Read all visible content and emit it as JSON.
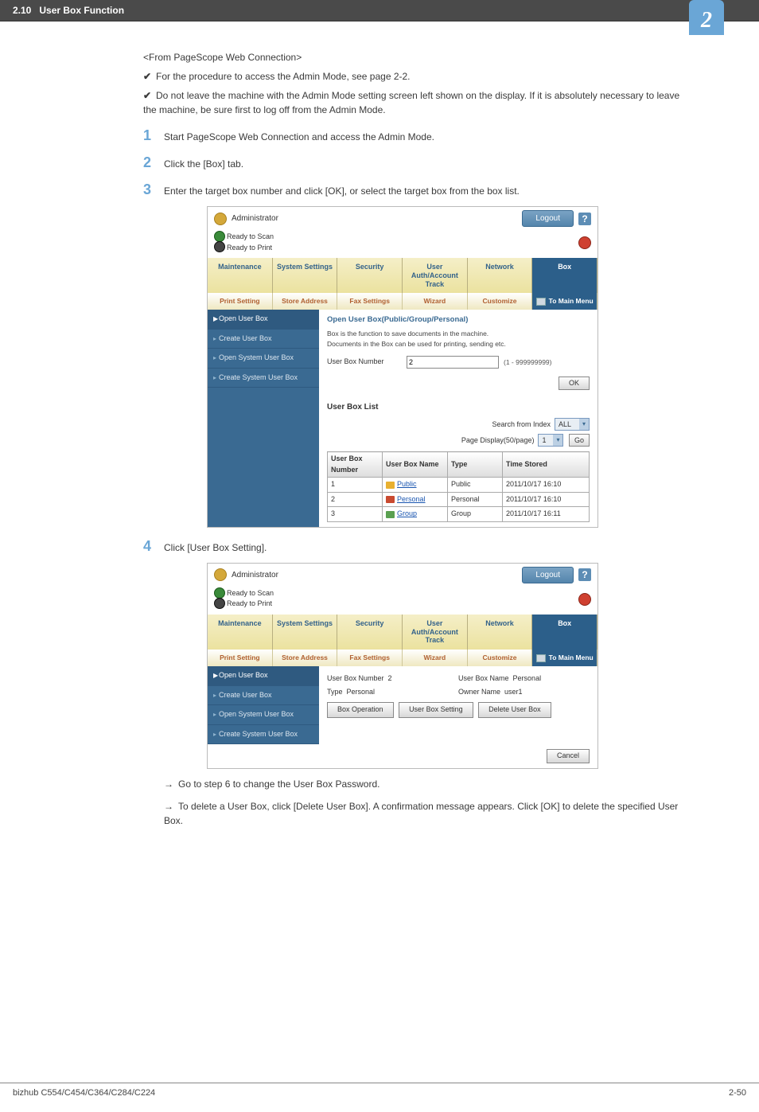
{
  "header": {
    "section": "2.10",
    "title": "User Box Function",
    "chapter_num": "2"
  },
  "intro": {
    "from": "<From PageScope Web Connection>",
    "bullets": [
      "For the procedure to access the Admin Mode, see page 2-2.",
      "Do not leave the machine with the Admin Mode setting screen left shown on the display. If it is absolutely necessary to leave the machine, be sure first to log off from the Admin Mode."
    ]
  },
  "steps": {
    "s1": "Start PageScope Web Connection and access the Admin Mode.",
    "s2": "Click the [Box] tab.",
    "s3": "Enter the target box number and click [OK], or select the target box from the box list.",
    "s4": "Click [User Box Setting]."
  },
  "shot": {
    "admin": "Administrator",
    "logout": "Logout",
    "help": "?",
    "status1": "Ready to Scan",
    "status2": "Ready to Print",
    "tabs1": [
      "Maintenance",
      "System Settings",
      "Security",
      "User Auth/Account Track",
      "Network",
      "Box"
    ],
    "tabs2": [
      "Print Setting",
      "Store Address",
      "Fax Settings",
      "Wizard",
      "Customize",
      "To Main Menu"
    ],
    "side": [
      "Open User Box",
      "Create User Box",
      "Open System User Box",
      "Create System User Box"
    ]
  },
  "shot1": {
    "heading": "Open User Box(Public/Group/Personal)",
    "desc1": "Box is the function to save documents in the machine.",
    "desc2": "Documents in the Box can be used for printing, sending etc.",
    "ubn_label": "User Box Number",
    "ubn_value": "2",
    "ubn_hint": "(1 - 999999999)",
    "ok": "OK",
    "list_heading": "User Box List",
    "search_label": "Search from Index",
    "search_sel": "ALL",
    "pagedisp_label": "Page Display(50/page)",
    "pagedisp_sel": "1",
    "go": "Go",
    "th": [
      "User Box Number",
      "User Box Name",
      "Type",
      "Time Stored"
    ],
    "rows": [
      {
        "n": "1",
        "name": "Public",
        "type": "Public",
        "time": "2011/10/17 16:10"
      },
      {
        "n": "2",
        "name": "Personal",
        "type": "Personal",
        "time": "2011/10/17 16:10"
      },
      {
        "n": "3",
        "name": "Group",
        "type": "Group",
        "time": "2011/10/17 16:11"
      }
    ]
  },
  "shot2": {
    "r1a_l": "User Box Number",
    "r1a_v": "2",
    "r1b_l": "User Box Name",
    "r1b_v": "Personal",
    "r2a_l": "Type",
    "r2a_v": "Personal",
    "r2b_l": "Owner Name",
    "r2b_v": "user1",
    "btns": [
      "Box Operation",
      "User Box Setting",
      "Delete User Box"
    ],
    "cancel": "Cancel"
  },
  "post": {
    "a": "Go to step 6 to change the User Box Password.",
    "b": "To delete a User Box, click [Delete User Box]. A confirmation message appears. Click [OK] to delete the specified User Box."
  },
  "footer": {
    "left": "bizhub C554/C454/C364/C284/C224",
    "right": "2-50"
  },
  "chart_data": {
    "type": "table",
    "title": "User Box List",
    "columns": [
      "User Box Number",
      "User Box Name",
      "Type",
      "Time Stored"
    ],
    "rows": [
      [
        1,
        "Public",
        "Public",
        "2011/10/17 16:10"
      ],
      [
        2,
        "Personal",
        "Personal",
        "2011/10/17 16:10"
      ],
      [
        3,
        "Group",
        "Group",
        "2011/10/17 16:11"
      ]
    ]
  }
}
